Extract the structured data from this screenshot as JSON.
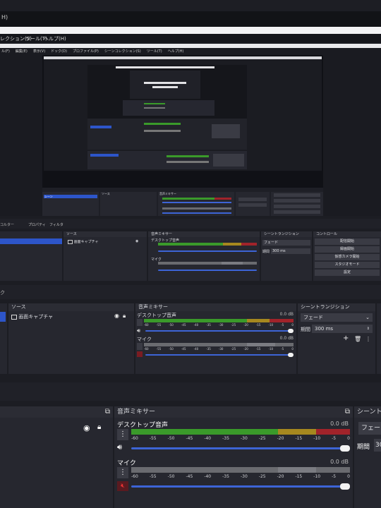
{
  "top": {
    "window_menu_fragment": "H)",
    "menu_items": [
      "レクション(S)",
      "ツール(T)",
      "ヘルプ(H)"
    ]
  },
  "tiny": {
    "menu_left": [
      "ル(F)",
      "編集(E)",
      "表示(V)",
      "ドック(D)",
      "プロファイル(P)",
      "シーンコレクション(S)",
      "ツール(T)",
      "ヘルプ(H)"
    ],
    "panel_sources": "ソース",
    "scene_item": "シーン",
    "mixer": "音声ミキサー",
    "desktop_audio": "デスクトップ音声",
    "mic": "マイク",
    "transitions": "シーントランジション",
    "controls": "コントロール",
    "controls_buttons": [
      "配信開始",
      "録画開始",
      "仮想カメラ開始",
      "スタジオモード",
      "設定"
    ],
    "fade": "フェード",
    "duration_label": "期間",
    "duration_value": "300 ms"
  },
  "level3": {
    "toolbar_left": "コルター",
    "toolbar_items": [
      "プロパティ",
      "フィルタ"
    ],
    "sources_title": "ソース",
    "source_item": "画面キャプチャ",
    "mixer_title": "音声ミキサー",
    "desktop_audio": "デスクトップ音声",
    "mic": "マイク",
    "transitions_title": "シーントランジション",
    "fade": "フェード",
    "duration_label": "期間",
    "duration_value": "300 ms",
    "controls_title": "コントロール",
    "controls_buttons": [
      "配信開始",
      "録画開始",
      "仮想カメラ開始",
      "スタジオモード",
      "設定"
    ]
  },
  "level2": {
    "left_label": "ク",
    "sources_title": "ソース",
    "source_item": "画面キャプチャ",
    "mixer_title": "音声ミキサー",
    "desktop_audio": "デスクトップ音声",
    "desktop_db": "0.0 dB",
    "mic": "マイク",
    "mic_db": "0.0 dB",
    "transitions_title": "シーントランジション",
    "fade": "フェード",
    "duration_label": "期間",
    "duration_value": "300 ms",
    "ticks": [
      "-60",
      "-55",
      "-50",
      "-45",
      "-40",
      "-35",
      "-30",
      "-25",
      "-20",
      "-15",
      "-10",
      "-5",
      "0"
    ]
  },
  "level1": {
    "mixer_title": "音声ミキサー",
    "desktop_audio": "デスクトップ音声",
    "desktop_db": "0.0 dB",
    "mic": "マイク",
    "mic_db": "0.0 dB",
    "transitions_title": "シーントラ",
    "fade": "フェード",
    "duration_label": "期間",
    "duration_value": "30",
    "ticks": [
      "-60",
      "-55",
      "-50",
      "-45",
      "-40",
      "-35",
      "-30",
      "-25",
      "-20",
      "-15",
      "-10",
      "-5",
      "0"
    ]
  },
  "colors": {
    "bg": "#17181e",
    "panel": "#26272f",
    "header": "#2b2c34",
    "selection": "#2d55c9",
    "meter_green": "#3a9a2a",
    "meter_yellow": "#a6881f",
    "meter_red": "#a1232a",
    "slider": "#3d64d6"
  },
  "icons": [
    "popout-icon",
    "eye-icon",
    "lock-icon",
    "gear-menu-icon",
    "speaker-icon",
    "mute-speaker-icon",
    "plus-icon",
    "trash-icon",
    "dots-icon",
    "dropdown-icon",
    "spin-icon",
    "monitor-icon"
  ]
}
